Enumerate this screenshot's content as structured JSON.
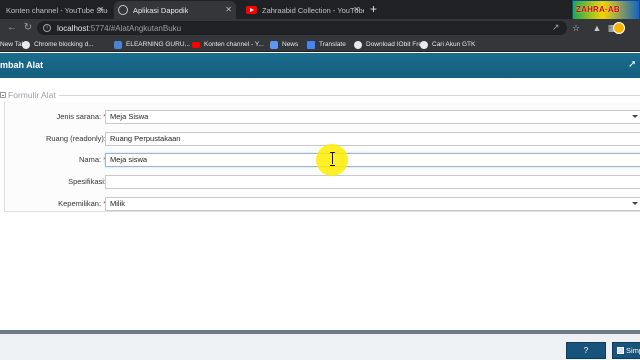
{
  "browser": {
    "tabs": [
      {
        "title": "Konten channel - YouTube Studio",
        "active": false
      },
      {
        "title": "Aplikasi Dapodik",
        "active": true
      },
      {
        "title": "Zahraabid Collection - YouTube",
        "active": false
      }
    ],
    "close_glyph": "✕",
    "new_tab_glyph": "+",
    "banner_text": "ZAHRA·AB",
    "url_host": "localhost",
    "url_path": ":5774/#AlatAngkutanBuku",
    "bookmarks": [
      {
        "label": "New Tab",
        "icon": "none"
      },
      {
        "label": "Chrome blocking d...",
        "icon": "globe-icon"
      },
      {
        "label": "ELEARNING GURU...",
        "icon": "elearning-icon"
      },
      {
        "label": "Konten channel - Y...",
        "icon": "youtube-icon"
      },
      {
        "label": "News",
        "icon": "news-icon"
      },
      {
        "label": "Translate",
        "icon": "translate-icon"
      },
      {
        "label": "Download IObit Fre...",
        "icon": "globe-icon"
      },
      {
        "label": "Cari Akun GTK",
        "icon": "globe-icon"
      }
    ]
  },
  "app": {
    "title": "mbah Alat",
    "legend": "Formulir Alat",
    "fields": [
      {
        "label": "Jenis sarana:",
        "required": true,
        "value": "Meja Siswa",
        "type": "select"
      },
      {
        "label": "Ruang (readonly):",
        "required": false,
        "value": "Ruang Perpustakaan",
        "type": "readonly"
      },
      {
        "label": "Nama:",
        "required": true,
        "value": "Meja siswa",
        "type": "text"
      },
      {
        "label": "Spesifikasi:",
        "required": false,
        "value": "",
        "type": "text"
      },
      {
        "label": "Kepemilikan:",
        "required": true,
        "value": "Milik",
        "type": "select"
      }
    ],
    "required_mark": "*",
    "footer": {
      "help_label": "?",
      "save_label": "Simpan"
    }
  },
  "colors": {
    "header": "#1a6d8f",
    "button": "#17537a",
    "required": "#d32f2f",
    "cursor_highlight": "#ffec00"
  }
}
